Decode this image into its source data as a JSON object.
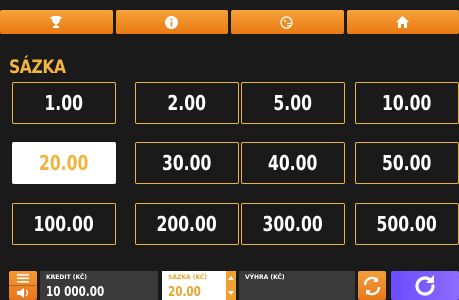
{
  "tabs": [
    {
      "icon": "trophy-icon"
    },
    {
      "icon": "info-icon"
    },
    {
      "icon": "paytable-icon"
    },
    {
      "icon": "home-icon"
    }
  ],
  "title": "SÁZKA",
  "bets": [
    "1.00",
    "2.00",
    "5.00",
    "10.00",
    "20.00",
    "30.00",
    "40.00",
    "50.00",
    "100.00",
    "200.00",
    "300.00",
    "500.00"
  ],
  "selected_bet": "20.00",
  "bottom": {
    "kredit_label": "KREDIT (KČ)",
    "kredit_value": "10 000.00",
    "sazka_label": "SÁZKA (KČ)",
    "sazka_value": "20.00",
    "vyhra_label": "VÝHRA (KČ)"
  },
  "colors": {
    "accent": "#f3b53f",
    "tab": "#ef8b22",
    "spin": "#7a5cff"
  }
}
